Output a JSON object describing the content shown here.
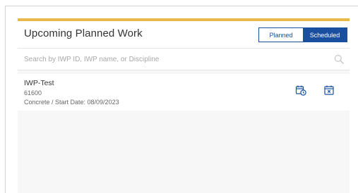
{
  "widget": {
    "title": "Upcoming Planned Work",
    "toggle": {
      "planned_label": "Planned",
      "scheduled_label": "Scheduled",
      "active": "Scheduled"
    },
    "search": {
      "placeholder": "Search by IWP ID, IWP name, or Discipline",
      "value": "",
      "icon": "search-icon"
    },
    "items": [
      {
        "name": "IWP-Test",
        "id": "61600",
        "meta": "Concrete / Start Date: 08/09/2023",
        "actions": [
          "calendar-clock-icon",
          "calendar-cancel-icon"
        ]
      }
    ]
  },
  "colors": {
    "accent_bar": "#e9b94a",
    "primary": "#1a4fa0",
    "panel_bg": "#f7f7f7"
  }
}
